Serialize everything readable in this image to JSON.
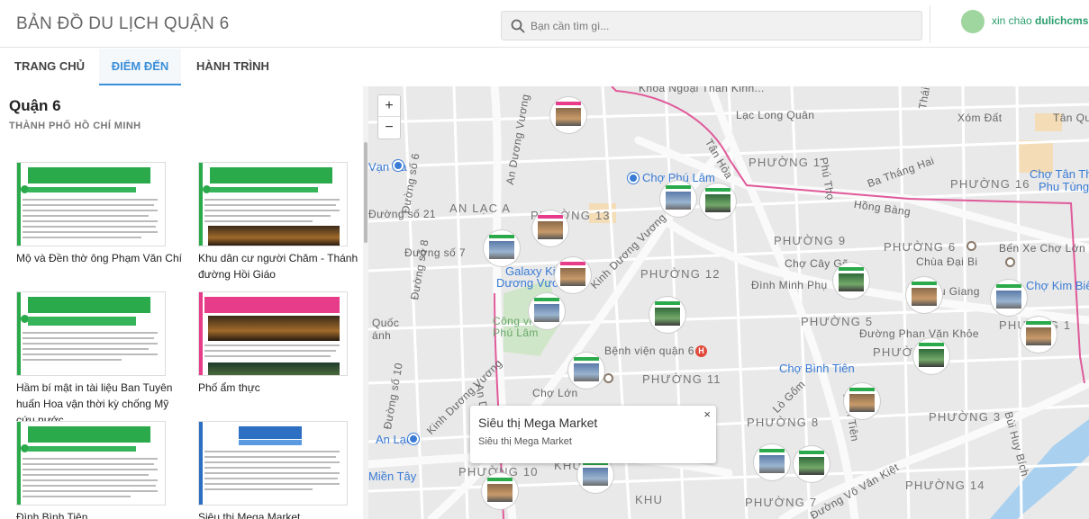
{
  "header": {
    "title": "BẢN ĐỒ DU LỊCH QUẬN 6",
    "search_placeholder": "Bạn cần tìm gì...",
    "greeting_prefix": "xin chào ",
    "username": "dulichcms"
  },
  "tabs": [
    {
      "label": "TRANG CHỦ"
    },
    {
      "label": "ĐIỂM ĐẾN"
    },
    {
      "label": "HÀNH TRÌNH"
    }
  ],
  "sidebar": {
    "title": "Quận 6",
    "subtitle": "THÀNH PHỐ HỒ CHÍ MINH",
    "places": [
      {
        "label": "Mộ và Đền thờ ông Phạm Văn Chí"
      },
      {
        "label": "Khu dân cư người Chăm - Thánh đường Hồi Giáo"
      },
      {
        "label": "Hầm bí mật in tài liệu Ban Tuyên huấn Hoa vận thời kỳ chống Mỹ cứu nước"
      },
      {
        "label": "Phố ẩm thực"
      },
      {
        "label": "Đình Bình Tiên"
      },
      {
        "label": "Siêu thị Mega Market"
      }
    ]
  },
  "map": {
    "zoom_in": "+",
    "zoom_out": "−",
    "labels": {
      "khoa": "Khoa Ngoại Thần Kinh...",
      "lac_long_quan": "Lạc Long Quân",
      "xom_dat": "Xóm Đất",
      "tan_quy": "Tân Quý",
      "thai": "Thái",
      "an_duong_vuong_top": "An Dương Vương",
      "tan_hoa": "Tân Hòa",
      "phuong1": "PHƯỜNG 1",
      "vo_sa": "Vạn Sa",
      "cho_phu_lam": "Chợ Phú Lâm",
      "phu_tho": "Phú Thọ",
      "ba_thang_hai": "Ba Tháng Hai",
      "phuong16": "PHƯỜNG 16",
      "cho_tan_tho": "Chợ Tân Thọ",
      "phu_tung": "Phu Tùng",
      "hong_bang": "Hồng Bàng",
      "duong_so6": "Đường số 6",
      "an_lac_a": "AN LẠC A",
      "phuong13": "PHƯỜNG 13",
      "phuong9": "PHƯỜNG 9",
      "phuong6": "PHƯỜNG 6",
      "ben_xe_cho_lon": "Bến Xe Chợ Lớn",
      "duong_so7": "Đường số 7",
      "kinh_duong_vuong": "Kinh Dương Vương",
      "cho_cay_go": "Chợ Cây Gõ",
      "chua_dai_bi": "Chùa Đại Bi",
      "duong_so21": "Đường số 21",
      "galaxy": "Galaxy Kinh",
      "duong_vuo": "Dương Vươ...",
      "phuong12": "PHƯỜNG 12",
      "dinh_minh_phu": "Đình Minh Phụ",
      "u_giang": "u Giang",
      "cho_kim_bien": "Chợ Kim Biên",
      "duong_so8": "Đường số 8",
      "quoc": "Quốc",
      "anh": "ánh",
      "cong_vien_phu_lam": "Công viên Phú Lâm",
      "phuong5": "PHƯỜNG 5",
      "duong_phan_van_khoe": "Đường Phan Văn Khỏe",
      "phuong1b": "PHƯỜNG 1",
      "benh_vien": "Bệnh viện quận 6",
      "phuong7": "PHƯỜNG 7",
      "cho_binh_tien": "Chợ Bình Tiên",
      "cho_lon": "Chợ Lớn",
      "phuong11": "PHƯỜNG 11",
      "lo_gom": "Lò Gốm",
      "duong_so10": "Đường số 10",
      "an_d": "An D",
      "kinh_duong_vuong2": "Kinh Dương Vương",
      "phuong8": "PHƯỜNG 8",
      "binh_tien": "Bình Tiên",
      "phuong3": "PHƯỜNG 3",
      "bui_huy_bich": "Bùi Huy Bích",
      "an_lac": "An Lạc",
      "mien_tay": "Miền Tây",
      "phuong10": "PHƯỜNG 10",
      "khu": "KHU 1",
      "vo_van_kiet": "Đường Võ Văn Kiệt",
      "phuong7b": "PHƯỜNG 7",
      "phuong14": "PHƯỜNG 14",
      "khu_b": "KHU"
    },
    "popup": {
      "title": "Siêu thị Mega Market",
      "subtitle": "Siêu thị Mega Market",
      "close": "×"
    },
    "hospital_glyph": "H"
  }
}
